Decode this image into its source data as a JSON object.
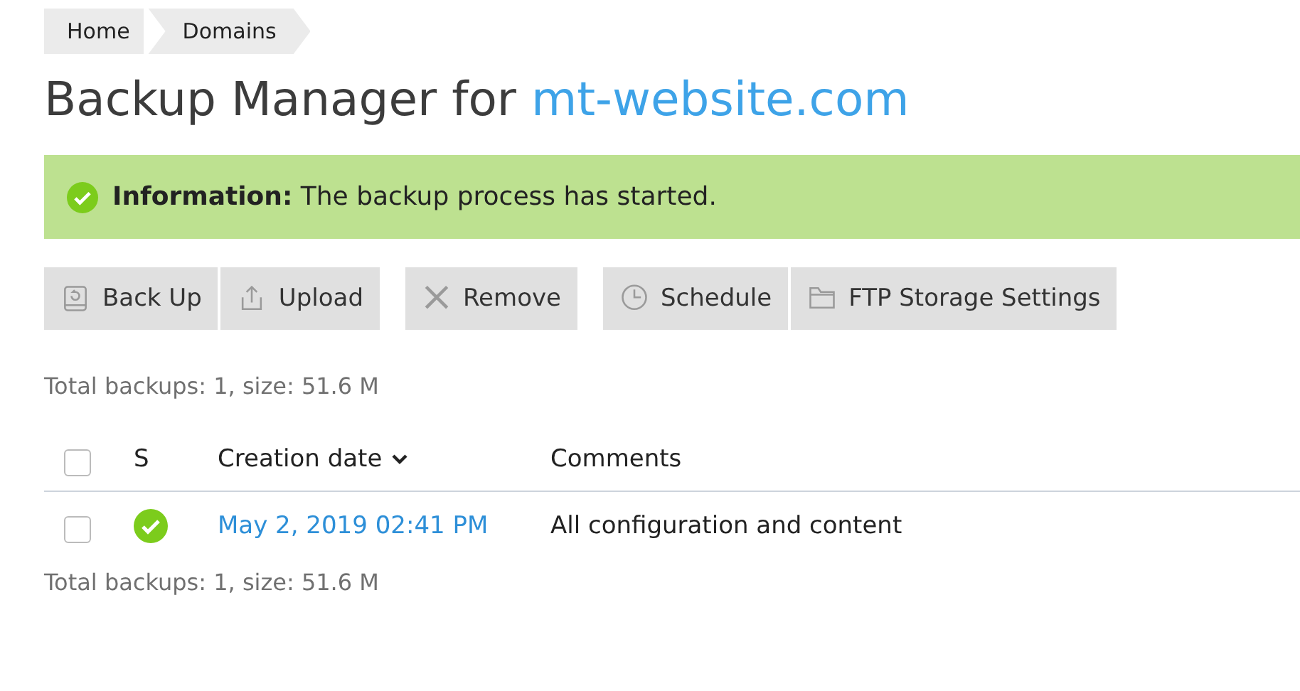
{
  "breadcrumbs": [
    "Home",
    "Domains"
  ],
  "title": {
    "text": "Backup Manager for ",
    "domain": "mt-website.com"
  },
  "alert": {
    "kind": "success",
    "message": "**Information:** The backup process has started."
  },
  "toolbar": [
    [
      "Back Up",
      "Upload"
    ],
    [
      "Remove"
    ],
    [
      "Schedule",
      "FTP Storage Settings"
    ]
  ],
  "summary_top": "Total backups: 1, size: 51.6 M",
  "table": {
    "select_all": {
      "checked": false
    },
    "columns": [
      {
        "label": "S",
        "sorted": false
      },
      {
        "label": "Creation date",
        "sorted": true
      },
      {
        "label": "Comments",
        "sorted": false
      }
    ],
    "rows": [
      {
        "checked": false,
        "success": true,
        "date": "May 2, 2019 02:41 PM",
        "comment": "All configuration and content"
      }
    ]
  },
  "summary_bottom": "Total backups: 1, size: 51.6 M"
}
